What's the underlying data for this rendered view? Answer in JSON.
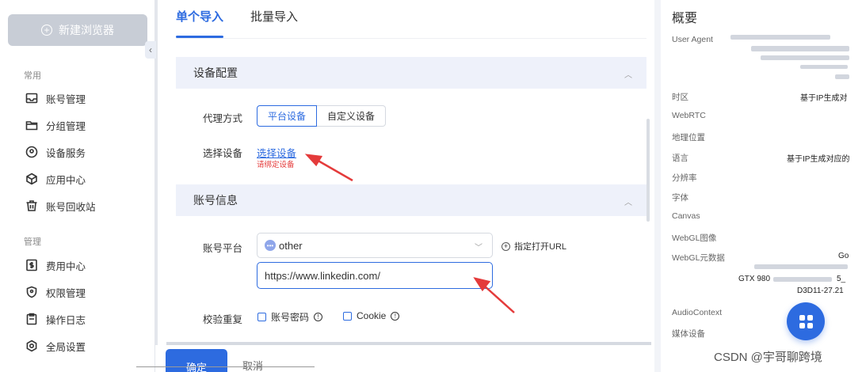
{
  "sidebar": {
    "new_browser_label": "新建浏览器",
    "groups": [
      {
        "title": "常用"
      },
      {
        "title": "管理"
      }
    ],
    "items": [
      {
        "label": "账号管理"
      },
      {
        "label": "分组管理"
      },
      {
        "label": "设备服务"
      },
      {
        "label": "应用中心"
      },
      {
        "label": "账号回收站"
      },
      {
        "label": "费用中心"
      },
      {
        "label": "权限管理"
      },
      {
        "label": "操作日志"
      },
      {
        "label": "全局设置"
      }
    ],
    "collapse_glyph": "‹"
  },
  "tabs": [
    {
      "label": "单个导入",
      "active": true
    },
    {
      "label": "批量导入",
      "active": false
    }
  ],
  "device_config": {
    "title": "设备配置",
    "proxy_label": "代理方式",
    "proxy_options": [
      "平台设备",
      "自定义设备"
    ],
    "select_label": "选择设备",
    "select_link": "选择设备",
    "warning": "请绑定设备"
  },
  "account_info": {
    "title": "账号信息",
    "platform_label": "账号平台",
    "platform_value": "other",
    "open_url_label": "指定打开URL",
    "url_value": "https://www.linkedin.com/",
    "dedupe_label": "校验重复",
    "dedupe_options": [
      "账号密码",
      "Cookie"
    ]
  },
  "footer": {
    "ok_label": "确定",
    "cancel_label": "取消"
  },
  "overview": {
    "title": "概要",
    "fields": [
      {
        "label": "User Agent",
        "value": ""
      },
      {
        "label": "时区",
        "value": "基于IP生成对"
      },
      {
        "label": "WebRTC",
        "value": ""
      },
      {
        "label": "地理位置",
        "value": ""
      },
      {
        "label": "语言",
        "value": "基于IP生成对应的"
      },
      {
        "label": "分辨率",
        "value": ""
      },
      {
        "label": "字体",
        "value": ""
      },
      {
        "label": "Canvas",
        "value": ""
      },
      {
        "label": "WebGL图像",
        "value": ""
      },
      {
        "label": "WebGL元数据",
        "value": "Go"
      },
      {
        "label": "AudioContext",
        "value": ""
      },
      {
        "label": "媒体设备",
        "value": ""
      }
    ],
    "webgl_line2": "GTX 980",
    "webgl_line2_tail": "5_",
    "webgl_line3": "D3D11-27.21"
  },
  "watermark": "CSDN @宇哥聊跨境",
  "colors": {
    "accent": "#2d6be0",
    "warning": "#e43b3b",
    "section_bg": "#eef1fa"
  }
}
